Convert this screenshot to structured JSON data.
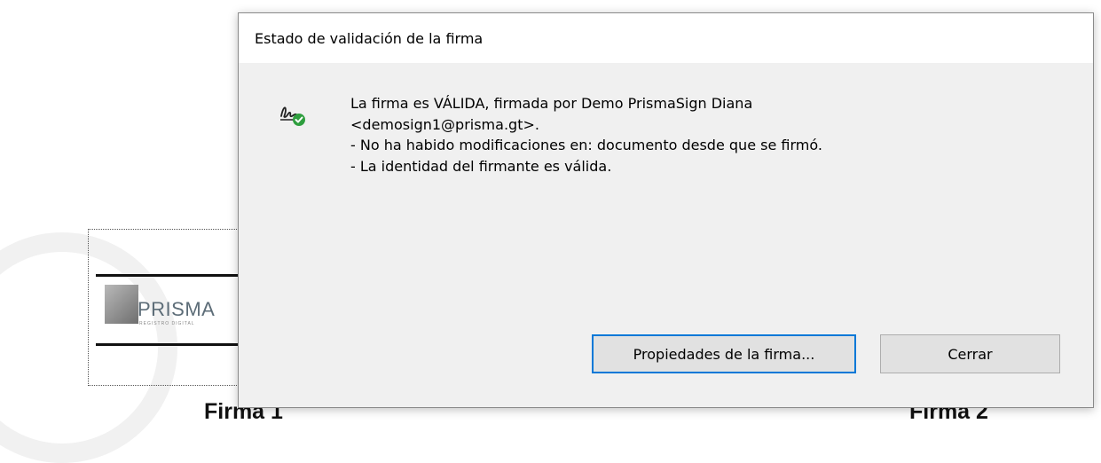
{
  "background": {
    "logo_text": "PRISMA",
    "logo_subtitle": "REGISTRO DIGITAL",
    "signature_label_1": "Firma 1",
    "signature_label_2": "Firma 2"
  },
  "dialog": {
    "title": "Estado de validación de la firma",
    "icon": "signature-valid-icon",
    "message_lines": [
      "La firma es VÁLIDA, firmada por Demo  PrismaSign Diana",
      "<demosign1@prisma.gt>.",
      "- No ha habido modificaciones en: documento desde que se firmó.",
      "- La identidad del firmante es válida."
    ],
    "buttons": {
      "properties": "Propiedades de la firma...",
      "close": "Cerrar"
    }
  },
  "colors": {
    "accent": "#0078d7",
    "valid_check": "#2e9e3e",
    "dialog_bg": "#f0f0f0"
  }
}
